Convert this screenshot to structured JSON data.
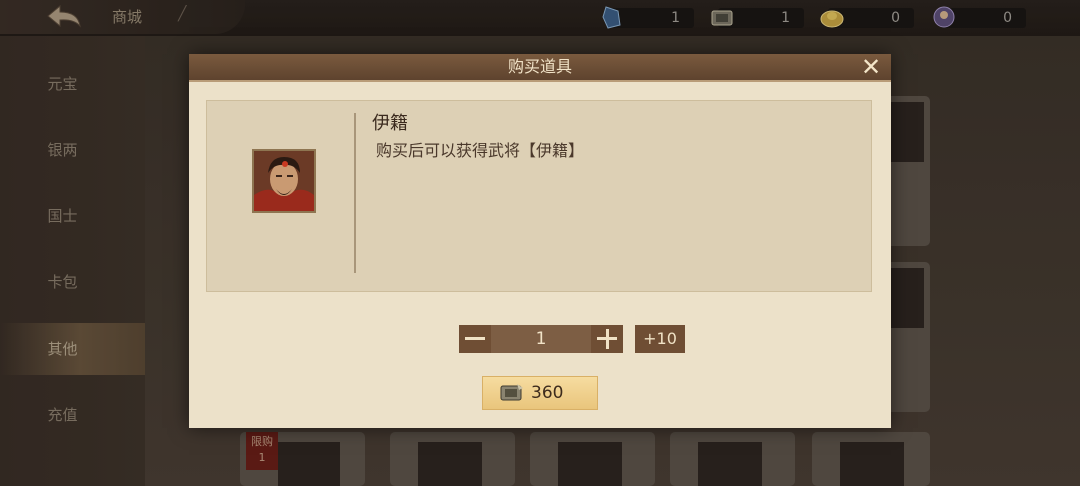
{
  "header": {
    "title": "商城",
    "back_icon": "back-arrow-icon",
    "resources": [
      {
        "icon": "blue-crystal-icon",
        "count": "1"
      },
      {
        "icon": "general-token-icon",
        "count": "1"
      },
      {
        "icon": "gold-ingot-icon",
        "count": "0"
      },
      {
        "icon": "warrior-token-icon",
        "count": "0"
      }
    ]
  },
  "sidebar": {
    "items": [
      {
        "label": "元宝"
      },
      {
        "label": "银两"
      },
      {
        "label": "国士"
      },
      {
        "label": "卡包"
      },
      {
        "label": "其他"
      },
      {
        "label": "充值"
      }
    ],
    "active_index": 4
  },
  "background": {
    "limit_tag": {
      "label": "限购",
      "count": "1"
    }
  },
  "dialog": {
    "title": "购买道具",
    "item": {
      "name": "伊籍",
      "description": "购买后可以获得武将【伊籍】",
      "portrait_icon": "hero-portrait-icon"
    },
    "quantity": "1",
    "plus10_label": "+10",
    "buy": {
      "price": "360",
      "currency_icon": "general-token-icon"
    }
  },
  "colors": {
    "dialog_bg": "#ece1c9",
    "header_bg": "#6b4d35",
    "button_brown": "#6f4e34",
    "buy_gold": "#efcf8c"
  }
}
